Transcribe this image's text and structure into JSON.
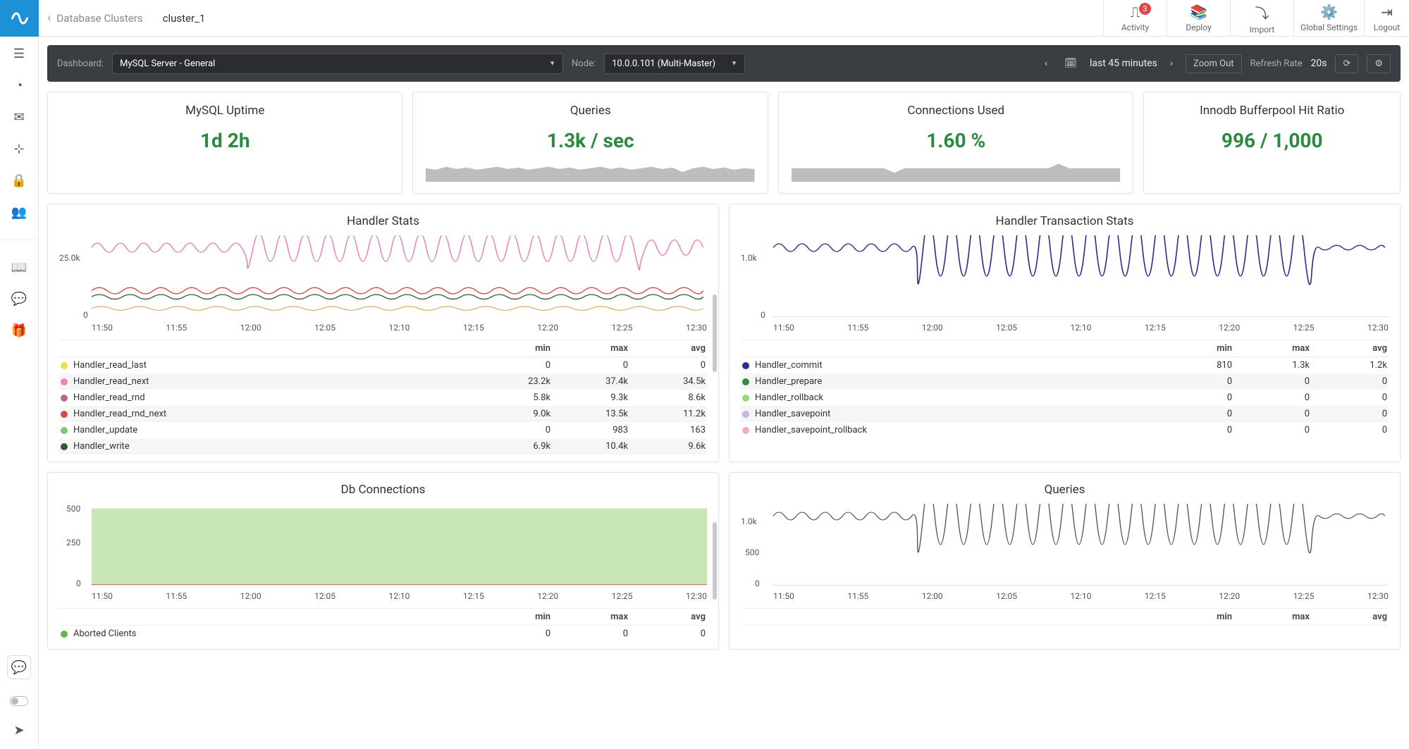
{
  "breadcrumb": {
    "back": "Database Clusters",
    "current": "cluster_1"
  },
  "topbar": {
    "activity": "Activity",
    "activity_badge": "3",
    "deploy": "Deploy",
    "import": "Import",
    "global_settings": "Global Settings",
    "logout": "Logout"
  },
  "darkbar": {
    "dashboard_label": "Dashboard:",
    "dashboard_value": "MySQL Server - General",
    "node_label": "Node:",
    "node_value": "10.0.0.101 (Multi-Master)",
    "range": "last 45 minutes",
    "zoom_out": "Zoom Out",
    "refresh_label": "Refresh Rate",
    "refresh_value": "20s"
  },
  "stats": {
    "uptime_title": "MySQL Uptime",
    "uptime_value": "1d 2h",
    "queries_title": "Queries",
    "queries_value": "1.3k / sec",
    "conn_title": "Connections Used",
    "conn_value": "1.60 %",
    "buffer_title": "Innodb Bufferpool Hit Ratio",
    "buffer_value": "996 / 1,000"
  },
  "chart_data": [
    {
      "type": "line",
      "title": "Handler Stats",
      "x_ticks": [
        "11:50",
        "11:55",
        "12:00",
        "12:05",
        "12:10",
        "12:15",
        "12:20",
        "12:25",
        "12:30"
      ],
      "y_ticks": [
        "25.0k",
        "0"
      ],
      "cols": [
        "min",
        "max",
        "avg"
      ],
      "series": [
        {
          "name": "Handler_read_last",
          "color": "#eadf4e",
          "min": "0",
          "max": "0",
          "avg": "0"
        },
        {
          "name": "Handler_read_next",
          "color": "#e48ab4",
          "min": "23.2k",
          "max": "37.4k",
          "avg": "34.5k"
        },
        {
          "name": "Handler_read_rnd",
          "color": "#b66b7e",
          "min": "5.8k",
          "max": "9.3k",
          "avg": "8.6k"
        },
        {
          "name": "Handler_read_rnd_next",
          "color": "#d14b4b",
          "min": "9.0k",
          "max": "13.5k",
          "avg": "11.2k"
        },
        {
          "name": "Handler_update",
          "color": "#7bc86f",
          "min": "0",
          "max": "983",
          "avg": "163"
        },
        {
          "name": "Handler_write",
          "color": "#315a3a",
          "min": "6.9k",
          "max": "10.4k",
          "avg": "9.6k"
        }
      ]
    },
    {
      "type": "line",
      "title": "Handler Transaction Stats",
      "x_ticks": [
        "11:50",
        "11:55",
        "12:00",
        "12:05",
        "12:10",
        "12:15",
        "12:20",
        "12:25",
        "12:30"
      ],
      "y_ticks": [
        "1.0k",
        "0"
      ],
      "cols": [
        "min",
        "max",
        "avg"
      ],
      "series": [
        {
          "name": "Handler_commit",
          "color": "#2b2f8c",
          "min": "810",
          "max": "1.3k",
          "avg": "1.2k"
        },
        {
          "name": "Handler_prepare",
          "color": "#3b873f",
          "min": "0",
          "max": "0",
          "avg": "0"
        },
        {
          "name": "Handler_rollback",
          "color": "#8de06b",
          "min": "0",
          "max": "0",
          "avg": "0"
        },
        {
          "name": "Handler_savepoint",
          "color": "#c2b7ec",
          "min": "0",
          "max": "0",
          "avg": "0"
        },
        {
          "name": "Handler_savepoint_rollback",
          "color": "#f0adc1",
          "min": "0",
          "max": "0",
          "avg": "0"
        }
      ]
    },
    {
      "type": "area",
      "title": "Db Connections",
      "x_ticks": [
        "11:50",
        "11:55",
        "12:00",
        "12:05",
        "12:10",
        "12:15",
        "12:20",
        "12:25",
        "12:30"
      ],
      "y_ticks": [
        "500",
        "250",
        "0"
      ],
      "cols": [
        "min",
        "max",
        "avg"
      ],
      "series": [
        {
          "name": "Aborted Clients",
          "color": "#63b34e",
          "min": "0",
          "max": "0",
          "avg": "0"
        }
      ]
    },
    {
      "type": "line",
      "title": "Queries",
      "x_ticks": [
        "11:50",
        "11:55",
        "12:00",
        "12:05",
        "12:10",
        "12:15",
        "12:20",
        "12:25",
        "12:30"
      ],
      "y_ticks": [
        "1.0k",
        "500",
        "0"
      ],
      "cols": [
        "min",
        "max",
        "avg"
      ],
      "series": []
    }
  ]
}
